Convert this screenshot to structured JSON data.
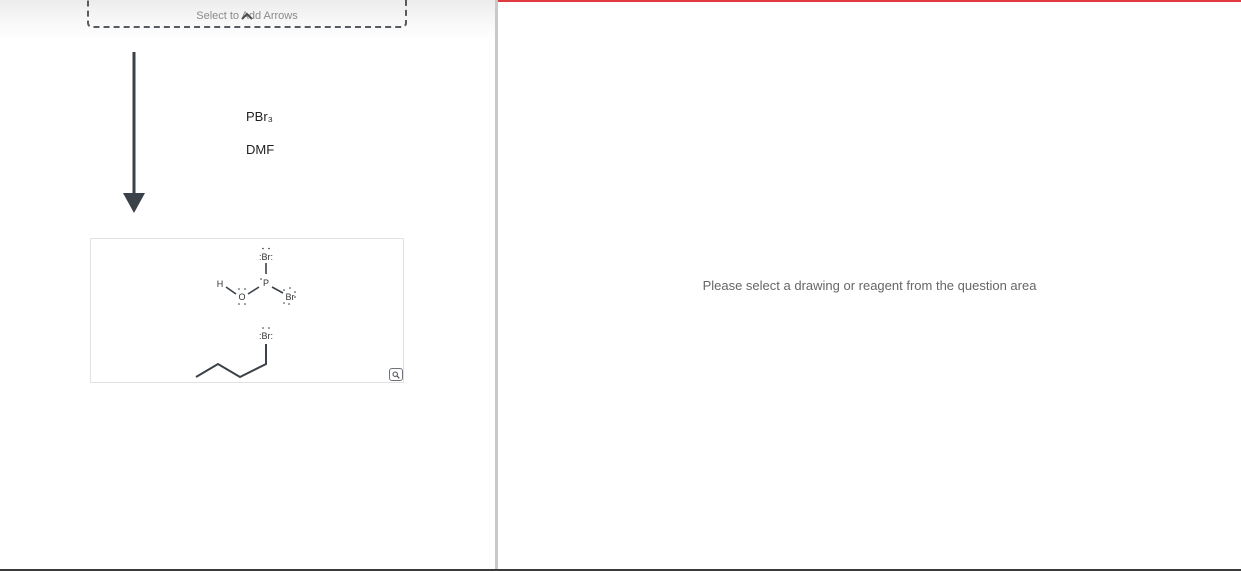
{
  "arrow_box": {
    "label": "Select to Add Arrows"
  },
  "reagents": [
    {
      "label": "PBr₃"
    },
    {
      "label": "DMF"
    }
  ],
  "molecule": {
    "atoms": {
      "br_top": ":Br:",
      "h": "H",
      "o": "O",
      "p": "P",
      "br_right": "Br",
      "br_chain": ":Br:"
    }
  },
  "right_panel": {
    "message": "Please select a drawing or reagent from the question area"
  },
  "colors": {
    "accent_line": "#e0393e",
    "arrow": "#3a4148",
    "bond": "#3a4148"
  },
  "icons": {
    "caret": "caret-up-icon",
    "reaction_arrow": "arrow-down-icon",
    "zoom": "magnifier-icon"
  }
}
